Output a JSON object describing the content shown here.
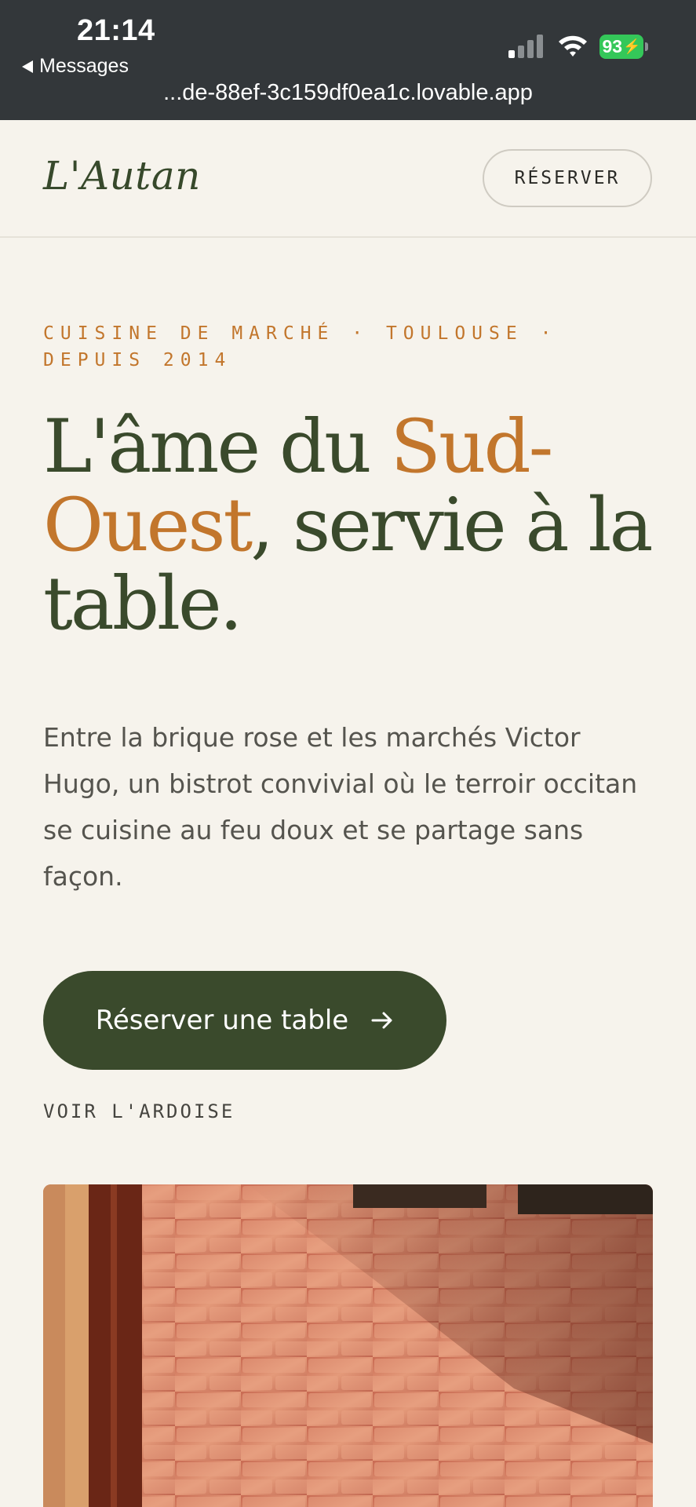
{
  "status_bar": {
    "time": "21:14",
    "back_label": "Messages",
    "url": "...de-88ef-3c159df0ea1c.lovable.app",
    "battery": "93",
    "battery_color": "#34c759"
  },
  "header": {
    "logo": "L'Autan",
    "reserve_label": "RÉSERVER"
  },
  "hero": {
    "eyebrow": "CUISINE DE MARCHÉ · TOULOUSE · DEPUIS 2014",
    "headline_part1": "L'âme du ",
    "headline_accent": "Sud-Ouest",
    "headline_part2": ", servie à la table.",
    "lede": "Entre la brique rose et les marchés Victor Hugo, un bistrot convivial où le terroir occitan se cuisine au feu doux et se partage sans façon.",
    "cta_label": "Réserver une table",
    "secondary_label": "VOIR L'ARDOISE"
  },
  "colors": {
    "background": "#f6f3ec",
    "brand_green": "#3a4a2c",
    "accent_ochre": "#c2762c",
    "statusbar": "#33373a"
  },
  "icons": {
    "cta_icon": "arrow-right-icon",
    "back_icon": "back-triangle-icon"
  }
}
